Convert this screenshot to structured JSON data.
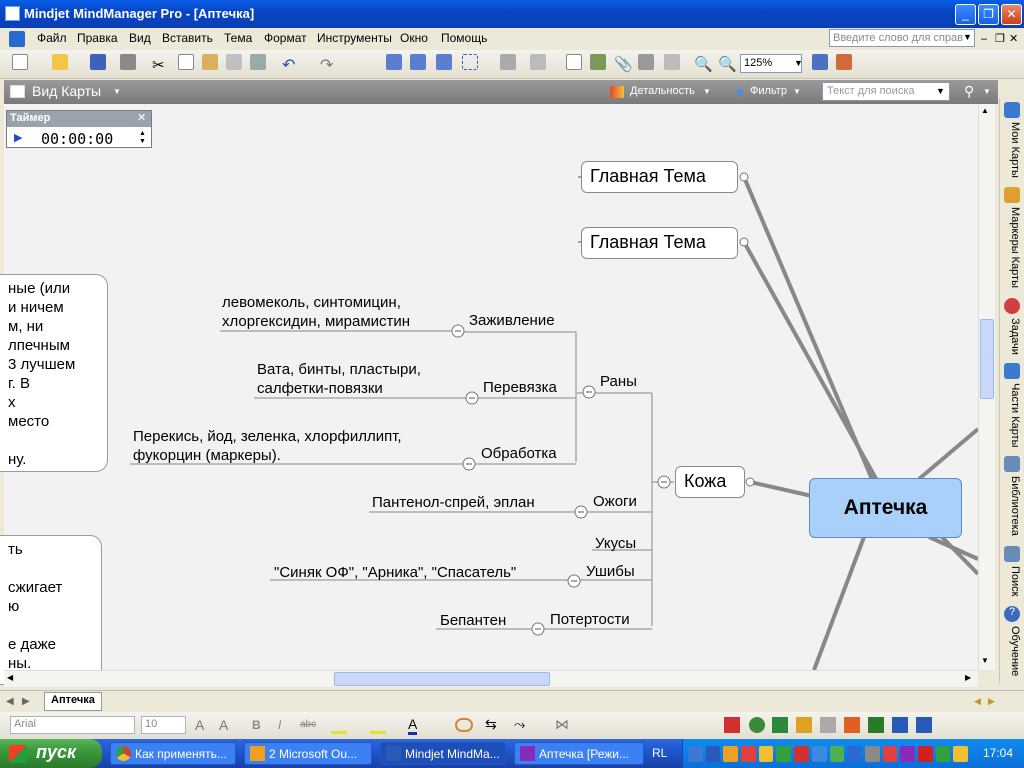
{
  "window": {
    "title": "Mindjet MindManager Pro - [Аптечка]"
  },
  "menu": {
    "items": [
      "Файл",
      "Правка",
      "Вид",
      "Вставить",
      "Тема",
      "Формат",
      "Инструменты",
      "Окно",
      "Помощь"
    ],
    "help_placeholder": "Введите слово для справ"
  },
  "toolbar": {
    "zoom": "125%"
  },
  "viewbar": {
    "view_label": "Вид Карты",
    "detail_label": "Детальность",
    "filter_label": "Фильтр",
    "search_placeholder": "Текст для поиска"
  },
  "timer": {
    "title": "Таймер",
    "value": "00:00:00"
  },
  "map": {
    "central": "Аптечка",
    "main_topics": [
      "Главная Тема",
      "Главная Тема",
      "Кожа"
    ],
    "subtopics": {
      "rany": "Раны",
      "zazhivlenie": "Заживление",
      "perevyazka": "Перевязка",
      "obrabotka": "Обработка",
      "ozhogi": "Ожоги",
      "ukusy": "Укусы",
      "ushiby": "Ушибы",
      "potertosti": "Потертости"
    },
    "notes": {
      "zazhivlenie_1": "левомеколь, синтомицин,",
      "zazhivlenie_2": "хлоргексидин, мирамистин",
      "perevyazka_1": "Вата, бинты, пластыри,",
      "perevyazka_2": "салфетки-повязки",
      "obrabotka_1": "Перекись, йод, зеленка, хлорфиллипт,",
      "obrabotka_2": "фукорцин (маркеры).",
      "ozhogi": "Пантенол-спрей, эплан",
      "ushiby": "\"Синяк ОФ\", \"Арника\", \"Спасатель\"",
      "potertosti": "Бепантен"
    },
    "textbox1": [
      "ные (или",
      "и ничем",
      "м, ни",
      "лпечным",
      "3 лучшем",
      "г. В",
      "х",
      "место",
      "",
      "ну."
    ],
    "textbox2": [
      "ть",
      "",
      "сжигает",
      "ю",
      "",
      "е даже",
      "ны."
    ]
  },
  "right_dock": {
    "tabs": [
      "Мои Карты",
      "Маркеры Карты",
      "Задачи",
      "Части Карты",
      "Библиотека",
      "Поиск",
      "Обучение"
    ]
  },
  "doc_tab": "Аптечка",
  "format_bar": {
    "font": "Arial",
    "size": "10"
  },
  "taskbar": {
    "start": "пуск",
    "tasks": [
      "Как применять...",
      "2 Microsoft Ou...",
      "Mindjet MindMa...",
      "Аптечка [Режи..."
    ],
    "lang": "RL",
    "clock": "17:04"
  },
  "colors": {
    "central_fill": "#a8d0f8",
    "connector": "#888888",
    "title_bar": "#0846c6",
    "taskbar": "#245edb"
  }
}
